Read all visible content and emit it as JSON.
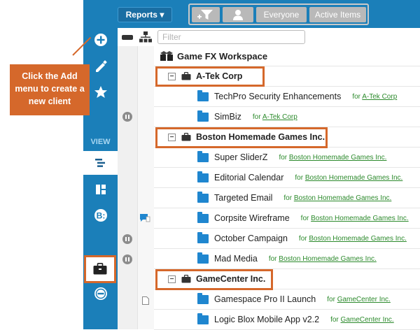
{
  "colors": {
    "rail": "#1b7fb9",
    "highlight": "#d5682b",
    "folder": "#1f86cf",
    "link": "#2c8a2c"
  },
  "topbar": {
    "reports_label": "Reports ▾",
    "filters": {
      "everyone_label": "Everyone",
      "active_label": "Active Items"
    }
  },
  "toolbar": {
    "filter_placeholder": "Filter"
  },
  "rail": {
    "view_label": "VIEW"
  },
  "callout": {
    "text": "Click the Add menu to create a new client"
  },
  "tree": {
    "root": "Game FX Workspace",
    "for_prefix": "for",
    "clients": [
      {
        "name": "A-Tek Corp",
        "projects": [
          {
            "name": "TechPro Security Enhancements",
            "client": "A-Tek Corp"
          },
          {
            "name": "SimBiz",
            "client": "A-Tek Corp"
          }
        ]
      },
      {
        "name": "Boston Homemade Games Inc.",
        "projects": [
          {
            "name": "Super SliderZ",
            "client": "Boston Homemade Games Inc."
          },
          {
            "name": "Editorial Calendar",
            "client": "Boston Homemade Games Inc."
          },
          {
            "name": "Targeted Email",
            "client": "Boston Homemade Games Inc."
          },
          {
            "name": "Corpsite Wireframe",
            "client": "Boston Homemade Games Inc."
          },
          {
            "name": "October Campaign",
            "client": "Boston Homemade Games Inc."
          },
          {
            "name": "Mad Media",
            "client": "Boston Homemade Games Inc."
          }
        ]
      },
      {
        "name": "GameCenter Inc.",
        "projects": [
          {
            "name": "Gamespace Pro II Launch",
            "client": "GameCenter Inc."
          },
          {
            "name": "Logic Blox Mobile App v2.2",
            "client": "GameCenter Inc."
          }
        ]
      }
    ]
  }
}
